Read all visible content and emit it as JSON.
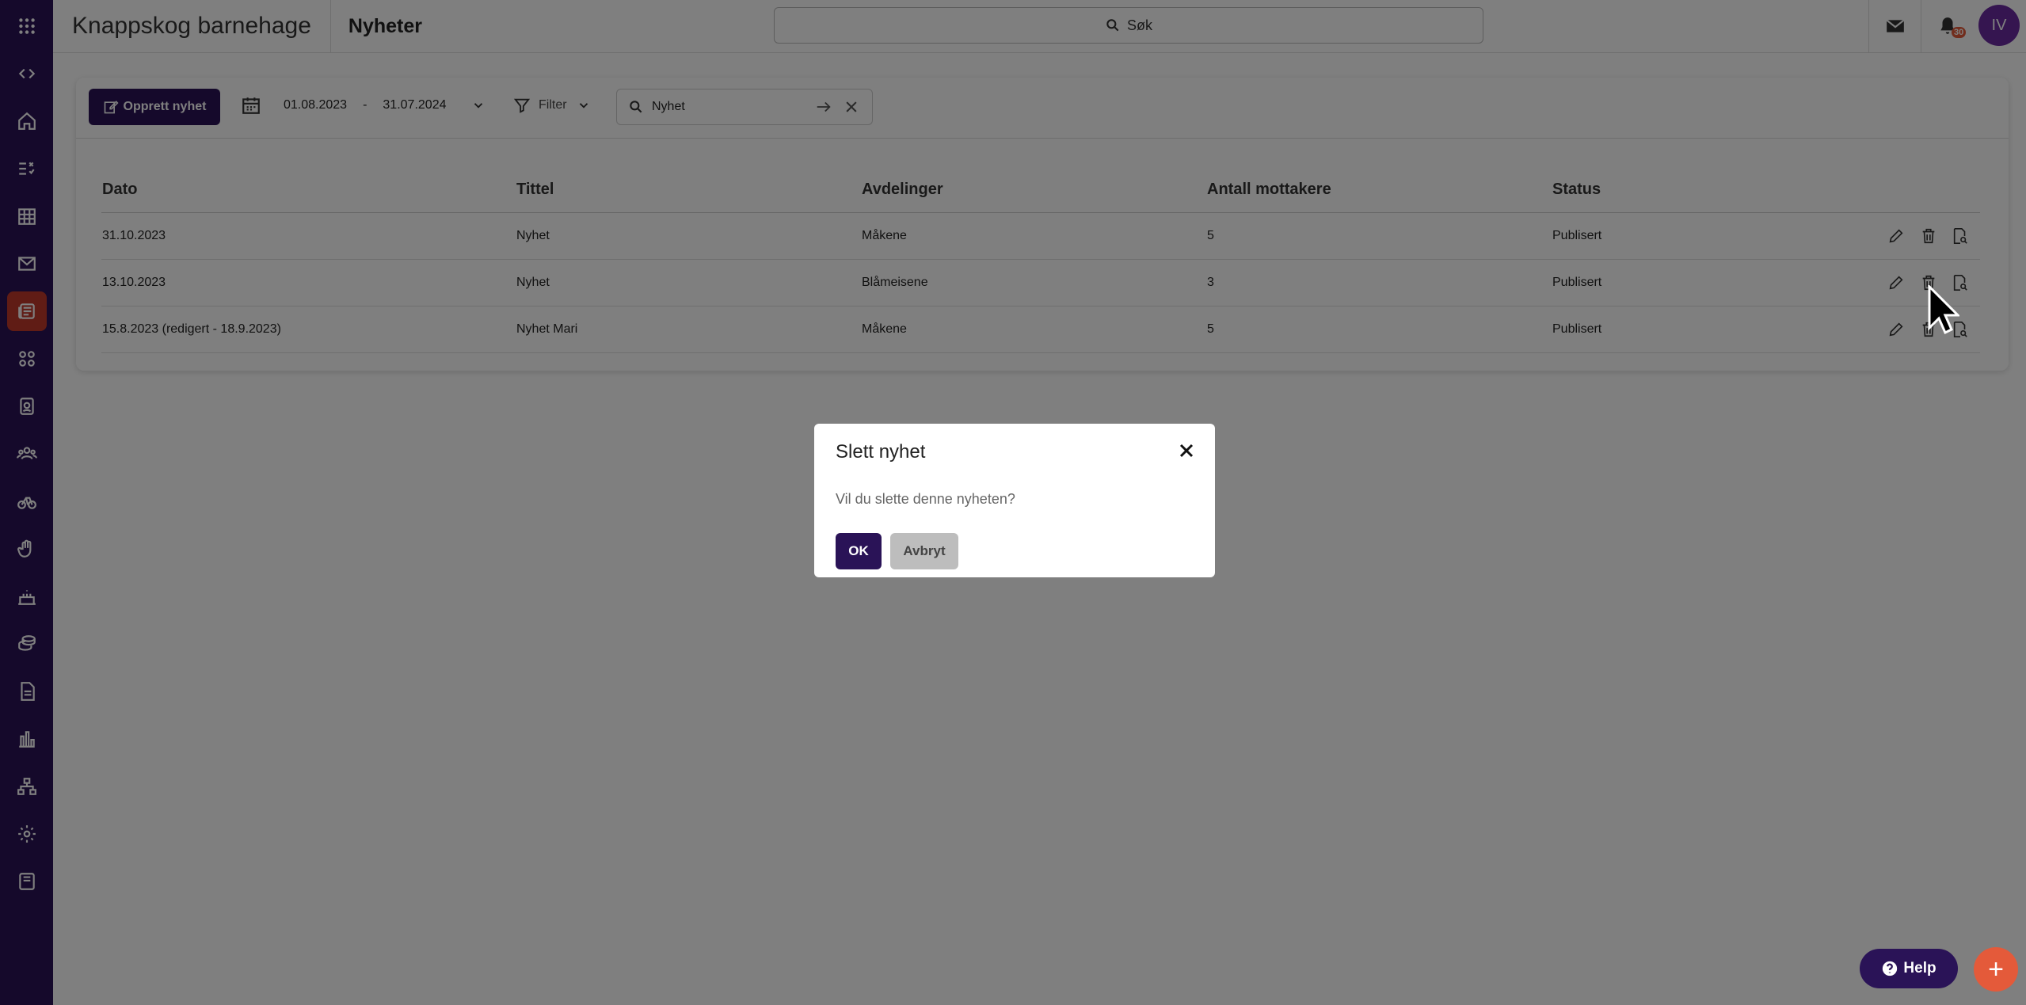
{
  "header": {
    "org_name": "Knappskog barnehage",
    "page_title": "Nyheter",
    "search_label": "Søk",
    "notification_count": "30",
    "avatar_initials": "IV"
  },
  "sidebar": {
    "icons": [
      "apps-icon",
      "collapse-icon",
      "home-icon",
      "checklist-icon",
      "calendar-grid-icon",
      "mail-icon",
      "news-icon",
      "groups-icon",
      "badge-icon",
      "people-icon",
      "bike-icon",
      "hand-icon",
      "cake-icon",
      "coins-icon",
      "document-icon",
      "chart-icon",
      "sitemap-icon",
      "gear-icon",
      "book-icon"
    ],
    "active_index": 6
  },
  "toolbar": {
    "create_label": "Opprett nyhet",
    "date_from": "01.08.2023",
    "date_separator": "-",
    "date_to": "31.07.2024",
    "filter_label": "Filter",
    "search_value": "Nyhet"
  },
  "table": {
    "headers": [
      "Dato",
      "Tittel",
      "Avdelinger",
      "Antall mottakere",
      "Status"
    ],
    "rows": [
      {
        "date": "31.10.2023",
        "title": "Nyhet",
        "departments": "Måkene",
        "recipients": "5",
        "status": "Publisert"
      },
      {
        "date": "13.10.2023",
        "title": "Nyhet",
        "departments": "Blåmeisene",
        "recipients": "3",
        "status": "Publisert"
      },
      {
        "date": "15.8.2023 (redigert - 18.9.2023)",
        "title": "Nyhet Mari",
        "departments": "Måkene",
        "recipients": "5",
        "status": "Publisert"
      }
    ]
  },
  "modal": {
    "title": "Slett nyhet",
    "message": "Vil du slette denne nyheten?",
    "ok_label": "OK",
    "cancel_label": "Avbryt"
  },
  "footer": {
    "help_label": "Help",
    "fab_label": "+"
  },
  "colors": {
    "brand": "#2a1357",
    "accent": "#e45a3a"
  }
}
